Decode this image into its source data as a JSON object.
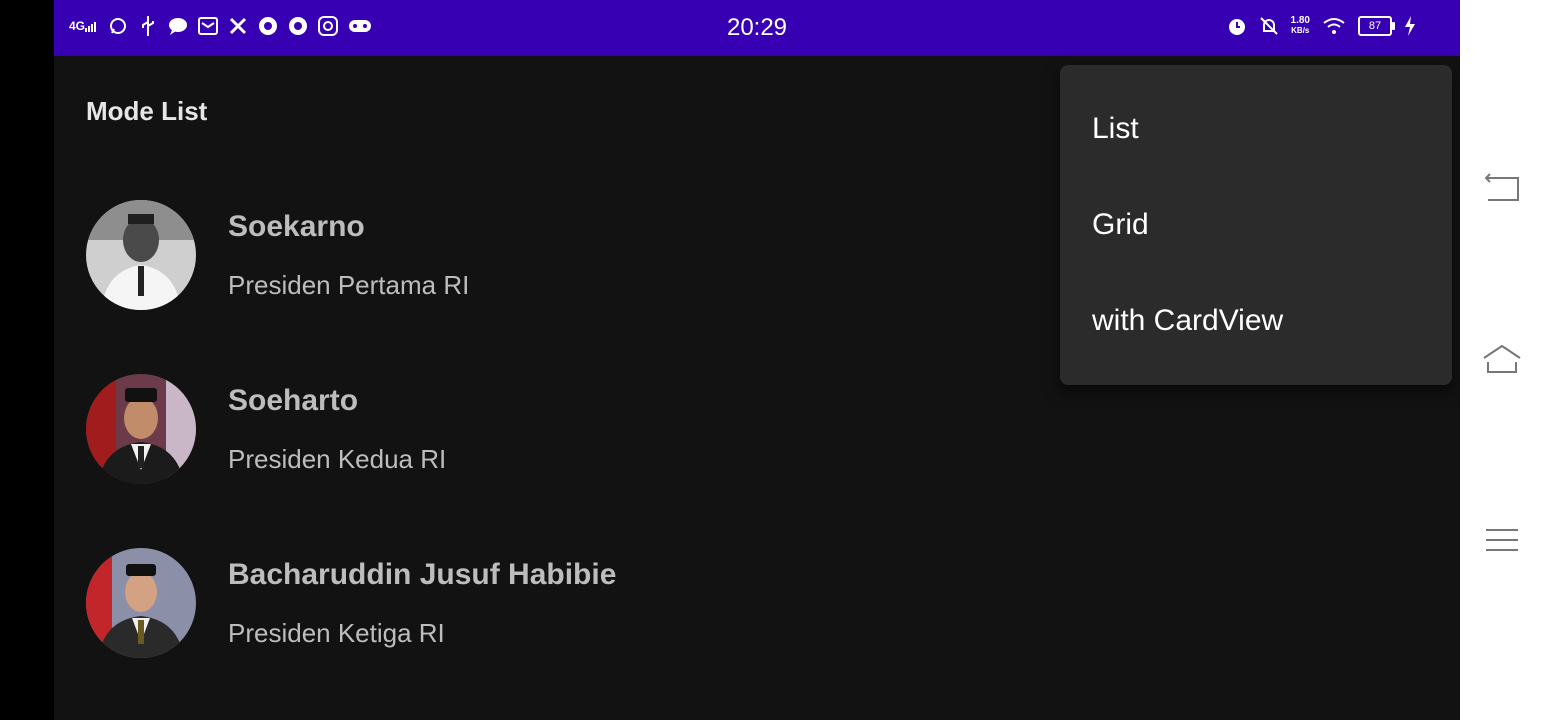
{
  "status_bar": {
    "time": "20:29",
    "network": "4G",
    "speed_value": "1.80",
    "speed_unit": "KB/s",
    "battery": "87",
    "bg_color": "#3700b3",
    "left_icons": [
      "network-icon",
      "whatsapp-icon",
      "usb-icon",
      "message-icon",
      "mail-icon",
      "tools-icon",
      "chrome-icon",
      "chrome-icon",
      "instagram-icon",
      "gamepad-icon"
    ],
    "right_icons": [
      "alarm-icon",
      "notifications-off-icon",
      "wifi-icon",
      "battery-icon",
      "charging-icon"
    ]
  },
  "app": {
    "title": "Mode List"
  },
  "list": {
    "items": [
      {
        "name": "Soekarno",
        "desc": "Presiden Pertama RI"
      },
      {
        "name": "Soeharto",
        "desc": "Presiden Kedua RI"
      },
      {
        "name": "Bacharuddin Jusuf Habibie",
        "desc": "Presiden Ketiga RI"
      }
    ]
  },
  "menu": {
    "items": [
      "List",
      "Grid",
      "with CardView"
    ]
  },
  "nav": {
    "icons": [
      "back-icon",
      "home-icon",
      "recents-icon"
    ]
  }
}
